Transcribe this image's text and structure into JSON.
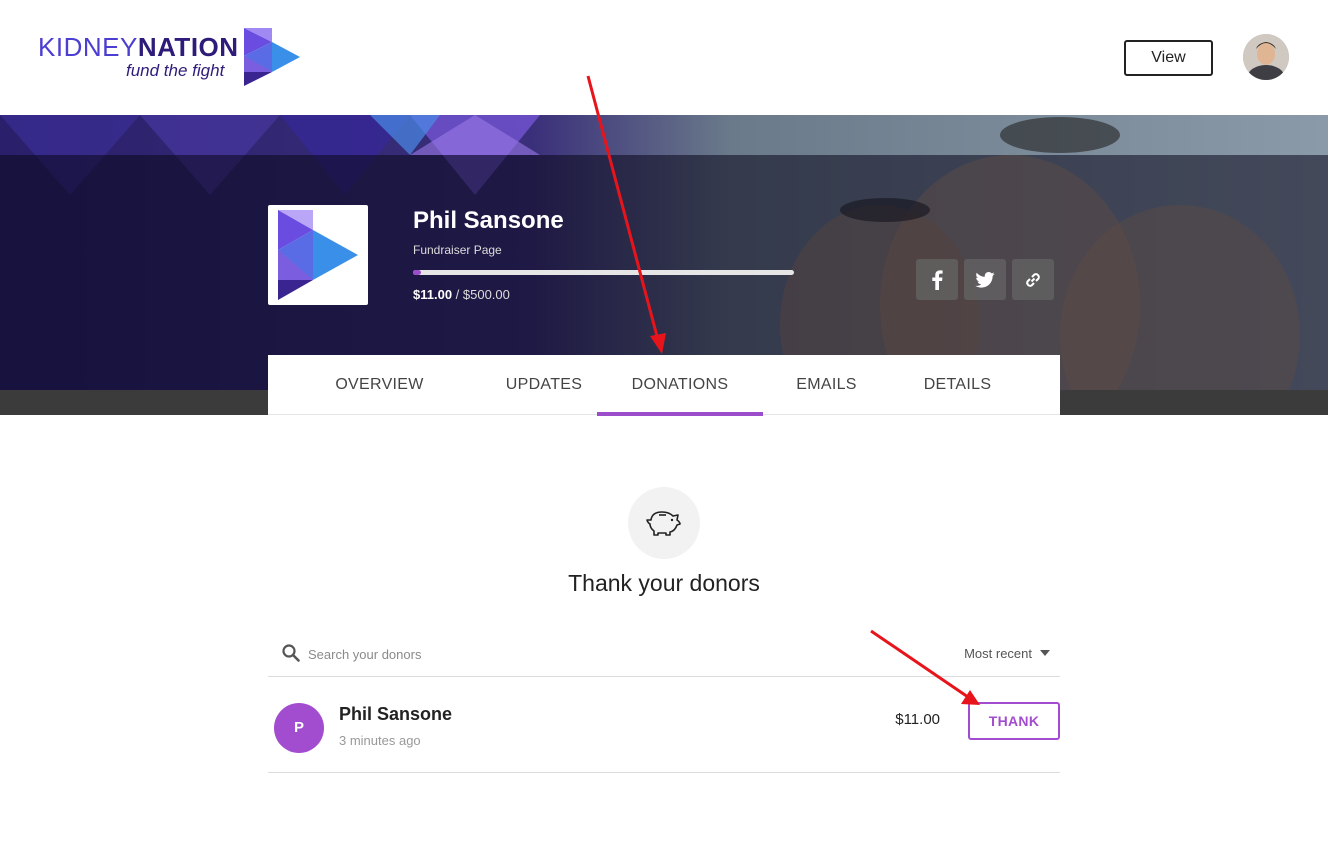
{
  "header": {
    "logo_word_light": "KIDNEY",
    "logo_word_bold": "NATION",
    "logo_tagline": "fund the fight",
    "view_label": "View"
  },
  "fundraiser": {
    "name": "Phil Sansone",
    "subtitle": "Fundraiser Page",
    "raised": "$11.00",
    "separator": " / ",
    "goal": "$500.00",
    "progress_fraction": 0.022
  },
  "tabs": [
    {
      "label": "OVERVIEW",
      "active": false
    },
    {
      "label": "UPDATES",
      "active": false
    },
    {
      "label": "DONATIONS",
      "active": true
    },
    {
      "label": "EMAILS",
      "active": false
    },
    {
      "label": "DETAILS",
      "active": false
    }
  ],
  "donations": {
    "heading": "Thank your donors",
    "search_placeholder": "Search your donors",
    "search_value": "",
    "sort_label": "Most recent",
    "donors": [
      {
        "initial": "P",
        "name": "Phil Sansone",
        "time": "3 minutes ago",
        "amount": "$11.00",
        "action": "THANK"
      }
    ]
  },
  "icons": {
    "share": [
      "facebook-icon",
      "twitter-icon",
      "link-icon"
    ],
    "empty_state": "piggy-bank-icon",
    "search": "search-icon",
    "sort": "caret-down-icon"
  },
  "colors": {
    "brand_purple": "#9b4dca",
    "avatar_purple": "#a24dcf",
    "annotation_red": "#e8141c"
  }
}
